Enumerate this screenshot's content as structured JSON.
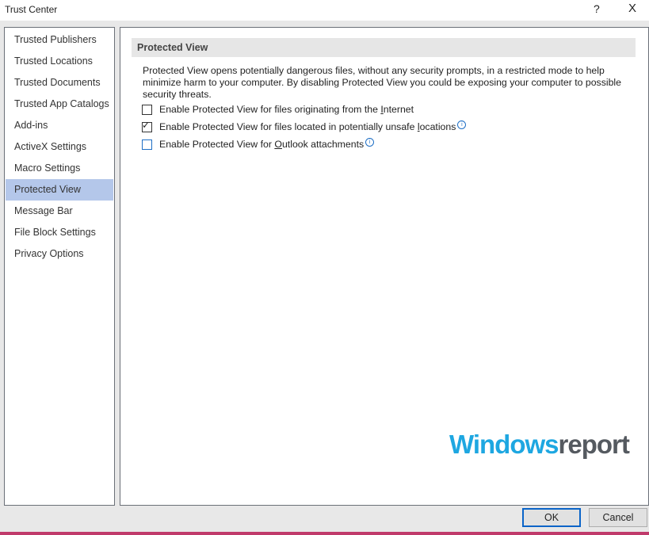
{
  "window": {
    "title": "Trust Center",
    "help_label": "?",
    "close_label": "X"
  },
  "sidebar": {
    "items": [
      {
        "label": "Trusted Publishers"
      },
      {
        "label": "Trusted Locations"
      },
      {
        "label": "Trusted Documents"
      },
      {
        "label": "Trusted App Catalogs"
      },
      {
        "label": "Add-ins"
      },
      {
        "label": "ActiveX Settings"
      },
      {
        "label": "Macro Settings"
      },
      {
        "label": "Protected View",
        "active": true
      },
      {
        "label": "Message Bar"
      },
      {
        "label": "File Block Settings"
      },
      {
        "label": "Privacy Options"
      }
    ]
  },
  "main": {
    "section_title": "Protected View",
    "description": "Protected View opens potentially dangerous files, without any security prompts, in a restricted mode to help minimize harm to your computer. By disabling Protected View you could be exposing your computer to possible security threats.",
    "options": [
      {
        "pre": "Enable Protected View for files originating from the ",
        "accel": "I",
        "post": "nternet",
        "checked": false,
        "info": false
      },
      {
        "pre": "Enable Protected View for files located in potentially unsafe ",
        "accel": "l",
        "post": "ocations",
        "checked": true,
        "info": true
      },
      {
        "pre": "Enable Protected View for ",
        "accel": "O",
        "post": "utlook attachments",
        "checked": false,
        "info": true
      }
    ],
    "info_glyph": "i",
    "check_glyph": "✓"
  },
  "watermark": {
    "part1": "Windows",
    "part2": "report"
  },
  "buttons": {
    "ok": "OK",
    "cancel": "Cancel"
  }
}
